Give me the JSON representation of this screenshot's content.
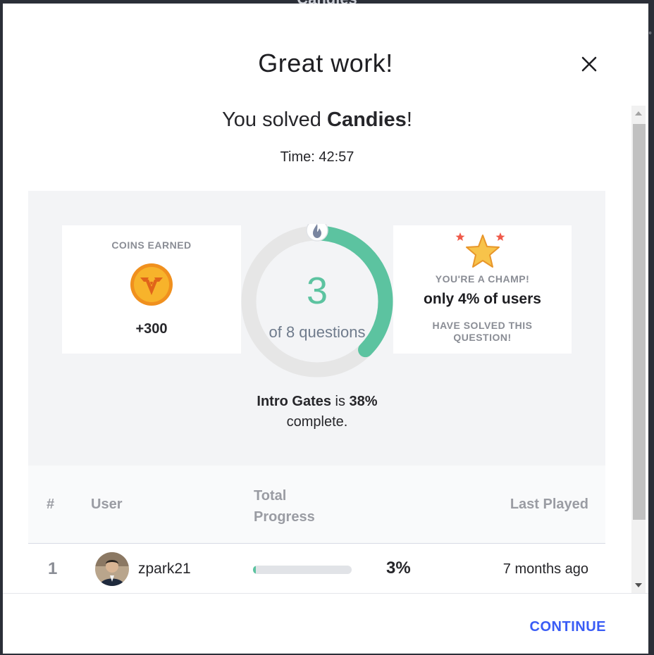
{
  "backdrop": {
    "title": "Candies"
  },
  "modal": {
    "title": "Great work!",
    "solved_prefix": "You solved ",
    "solved_name": "Candies",
    "solved_suffix": "!",
    "time": "Time: 42:57"
  },
  "coins": {
    "label": "COINS EARNED",
    "value": "+300"
  },
  "progress": {
    "solved": "3",
    "total_text": "of 8 questions",
    "fraction": 0.375,
    "course_name": "Intro Gates",
    "course_mid": " is ",
    "course_percent": "38%",
    "course_suffix": "complete."
  },
  "champ": {
    "label": "YOU'RE A CHAMP!",
    "main": "only 4% of users",
    "sub": "HAVE SOLVED THIS QUESTION!"
  },
  "table": {
    "headers": {
      "rank": "#",
      "user": "User",
      "progress": "Total Progress",
      "last": "Last Played"
    },
    "rows": [
      {
        "rank": "1",
        "user": "zpark21",
        "progress_percent": "3%",
        "progress_fraction": 0.03,
        "last_played": "7 months ago"
      }
    ]
  },
  "footer": {
    "continue_label": "CONTINUE"
  },
  "colors": {
    "accent_green": "#5cc3a0",
    "continue_blue": "#3a5cf5",
    "coin_orange": "#f5a623"
  }
}
